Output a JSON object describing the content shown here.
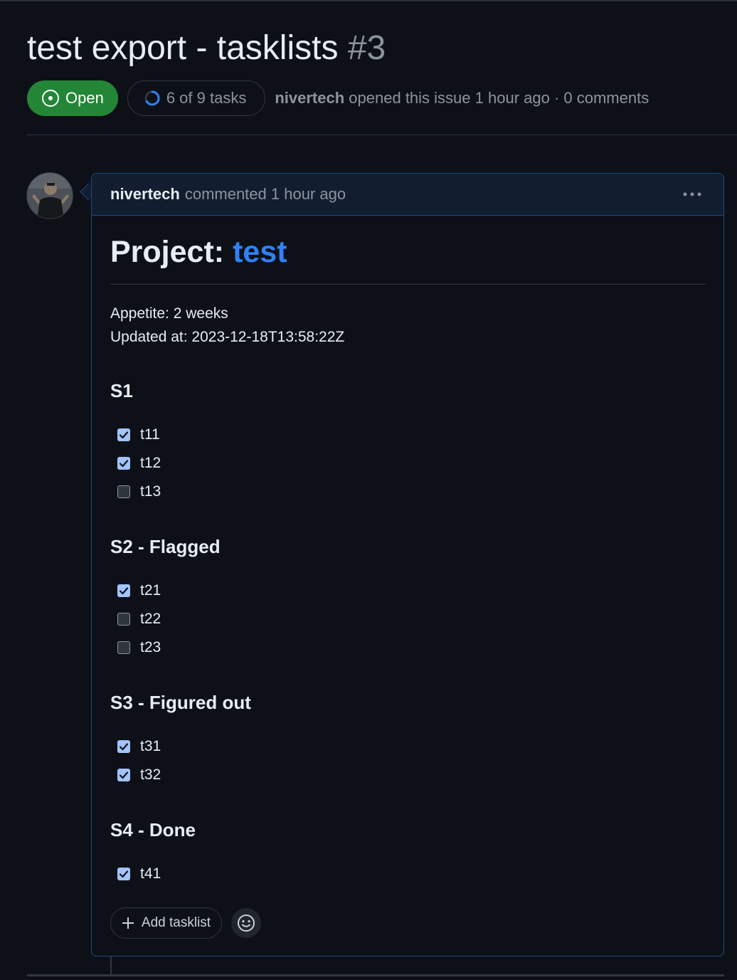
{
  "issue": {
    "title": "test export - tasklists",
    "number": "#3",
    "state": "Open",
    "progress_label": "6 of 9 tasks",
    "progress_done": 6,
    "progress_total": 9,
    "author": "nivertech",
    "opened_text": "opened this issue 1 hour ago · 0 comments"
  },
  "comment": {
    "author": "nivertech",
    "meta": "commented 1 hour ago",
    "heading_prefix": "Project:",
    "heading_link": "test",
    "appetite": "Appetite: 2 weeks",
    "updated": "Updated at: 2023-12-18T13:58:22Z",
    "sections": [
      {
        "title": "S1",
        "tasks": [
          {
            "label": "t11",
            "checked": true
          },
          {
            "label": "t12",
            "checked": true
          },
          {
            "label": "t13",
            "checked": false
          }
        ]
      },
      {
        "title": "S2 - Flagged",
        "tasks": [
          {
            "label": "t21",
            "checked": true
          },
          {
            "label": "t22",
            "checked": false
          },
          {
            "label": "t23",
            "checked": false
          }
        ]
      },
      {
        "title": "S3 - Figured out",
        "tasks": [
          {
            "label": "t31",
            "checked": true
          },
          {
            "label": "t32",
            "checked": true
          }
        ]
      },
      {
        "title": "S4 - Done",
        "tasks": [
          {
            "label": "t41",
            "checked": true
          }
        ]
      }
    ],
    "add_tasklist_label": "Add tasklist"
  },
  "colors": {
    "open_badge": "#238636",
    "link": "#2f81f7",
    "checkbox_on": "#a3c3fa",
    "border_accent": "#1f4a80"
  },
  "icons": {
    "state": "issue-opened-icon",
    "progress": "progress-ring-icon",
    "more": "kebab-horizontal-icon",
    "add": "plus-icon",
    "reaction": "smiley-icon"
  }
}
